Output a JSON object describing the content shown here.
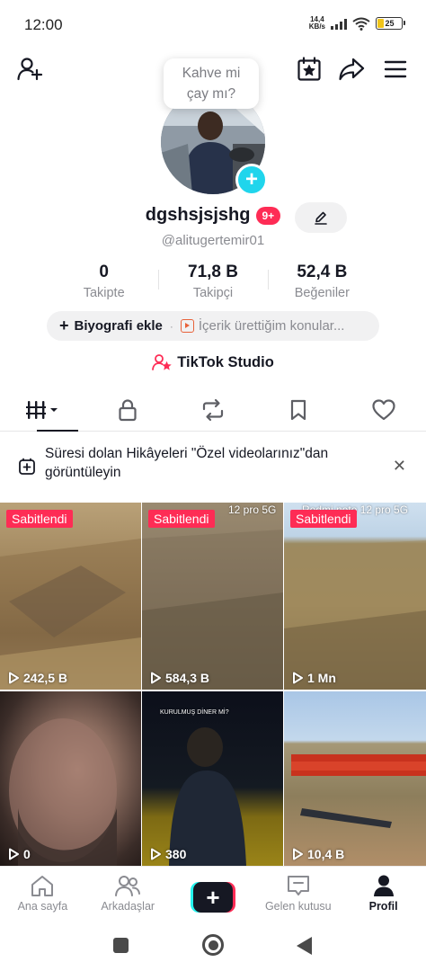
{
  "status_bar": {
    "time": "12:00",
    "net_speed_value": "14,4",
    "net_speed_unit": "KB/s",
    "battery_level": "25",
    "battery_color": "#f0c419"
  },
  "header": {
    "icons": [
      "add-friend-icon",
      "calendar-star-icon",
      "share-icon",
      "menu-icon"
    ]
  },
  "profile": {
    "bubble_text_line1": "Kahve mi",
    "bubble_text_line2": "çay mı?",
    "username": "dgshsjsjshg",
    "notification_badge": "9+",
    "handle": "@alitugertemir01",
    "stats": [
      {
        "value": "0",
        "label": "Takipte"
      },
      {
        "value": "71,8 B",
        "label": "Takipçi"
      },
      {
        "value": "52,4 B",
        "label": "Beğeniler"
      }
    ],
    "bio_add_label": "Biyografi ekle",
    "bio_topic_label": "İçerik ürettiğim konular...",
    "studio_label": "TikTok Studio"
  },
  "tabs": [
    "videos-grid-icon",
    "lock-icon",
    "repost-icon",
    "bookmark-icon",
    "heart-icon"
  ],
  "story_banner": {
    "text": "Süresi dolan Hikâyeleri \"Özel videolarınız\"dan görüntüleyin"
  },
  "videos": [
    {
      "pinned_label": "Sabitlendi",
      "views": "242,5 B"
    },
    {
      "pinned_label": "Sabitlendi",
      "overlay_text": "12 pro 5G",
      "views": "584,3 B"
    },
    {
      "pinned_label": "Sabitlendi",
      "overlay_text": "Redmi note 12 pro 5G",
      "views": "1 Mn"
    },
    {
      "views": "0"
    },
    {
      "overlay_text": "KURULMUŞ DİNER Mİ?",
      "views": "380"
    },
    {
      "views": "10,4 B"
    }
  ],
  "bottom_nav": {
    "home": "Ana sayfa",
    "friends": "Arkadaşlar",
    "inbox": "Gelen kutusu",
    "profile": "Profil"
  },
  "colors": {
    "accent_red": "#fe2c55",
    "accent_cyan": "#20d5ec",
    "text_primary": "#161823",
    "text_secondary": "#8a8b91"
  }
}
